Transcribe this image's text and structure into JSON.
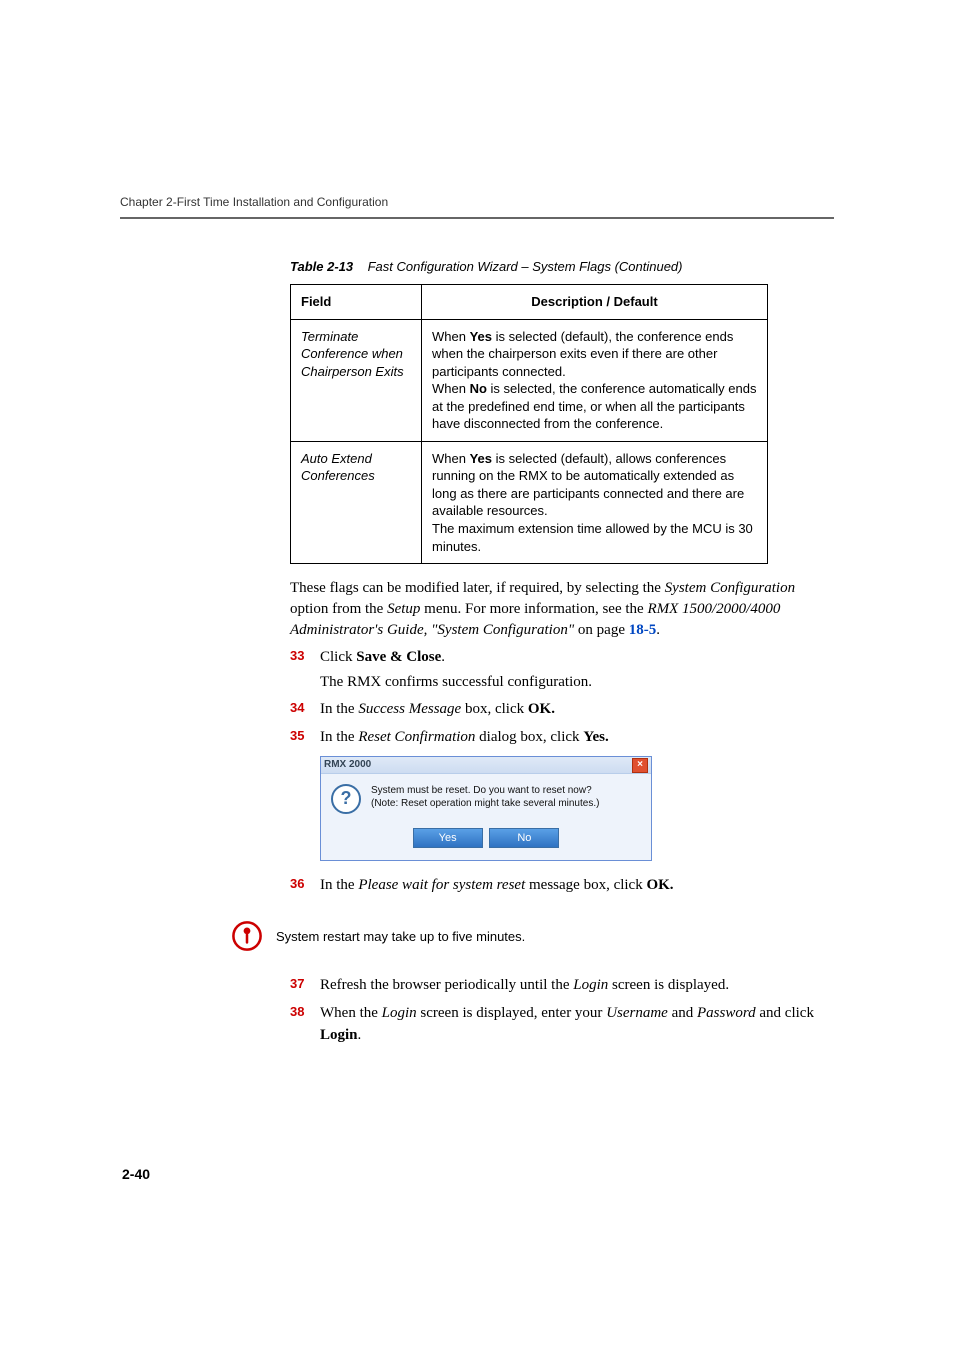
{
  "header": {
    "text": "Chapter 2-First Time Installation and Configuration"
  },
  "caption": {
    "label": "Table 2-13",
    "title": "Fast Configuration Wizard – System Flags (Continued)"
  },
  "table": {
    "head": {
      "field": "Field",
      "desc": "Description / Default"
    },
    "rows": [
      {
        "field": "Terminate Conference when Chairperson Exits",
        "desc_parts": {
          "p1a": "When ",
          "p1b": "Yes",
          "p1c": " is selected (default), the conference ends when the chairperson exits even if there are other participants connected.",
          "p2a": "When ",
          "p2b": "No",
          "p2c": " is selected, the conference automatically ends at the predefined end time, or when all the participants have disconnected from the conference."
        }
      },
      {
        "field": "Auto Extend Conferences",
        "desc_parts": {
          "p1a": "When ",
          "p1b": "Yes",
          "p1c": " is selected (default), allows conferences running on the RMX to be automatically extended as long as there are participants connected and there are available resources.",
          "p2": "The maximum extension time allowed by the MCU is 30 minutes."
        }
      }
    ]
  },
  "body": {
    "intro": {
      "t1": "These flags can be modified later, if required, by selecting the ",
      "i1": "System Configuration",
      "t2": " option from the ",
      "i2": "Setup",
      "t3": " menu. For more information, see the ",
      "i3": "RMX 1500/2000/4000 Administrator's Guide, \"System Configuration\"",
      "t4": " on page ",
      "link": "18-5",
      "t5": "."
    },
    "s33": {
      "num": "33",
      "t1": "Click ",
      "b1": "Save & Close",
      "t2": ".",
      "sub": "The RMX confirms successful configuration."
    },
    "s34": {
      "num": "34",
      "t1": "In the ",
      "i1": "Success Message",
      "t2": " box, click ",
      "b1": "OK."
    },
    "s35": {
      "num": "35",
      "t1": "In the ",
      "i1": "Reset Confirmation",
      "t2": " dialog box, click ",
      "b1": "Yes."
    },
    "s36": {
      "num": "36",
      "t1": "In the ",
      "i1": "Please wait for system reset",
      "t2": " message box, click ",
      "b1": "OK."
    },
    "s37": {
      "num": "37",
      "t1": "Refresh the browser periodically until the ",
      "i1": "Login",
      "t2": " screen is displayed."
    },
    "s38": {
      "num": "38",
      "t1": "When the ",
      "i1": "Login",
      "t2": " screen is displayed, enter your ",
      "i2": "Username",
      "t3": " and ",
      "i3": "Password",
      "t4": " and click ",
      "b1": "Login",
      "t5": "."
    }
  },
  "dialog": {
    "title": "RMX 2000",
    "msg1": "System must be reset. Do you want to reset now?",
    "msg2": "(Note: Reset operation might take several minutes.)",
    "yes": "Yes",
    "no": "No"
  },
  "note": {
    "text": "System restart may take up to five minutes."
  },
  "footer": {
    "pagenum": "2-40"
  }
}
